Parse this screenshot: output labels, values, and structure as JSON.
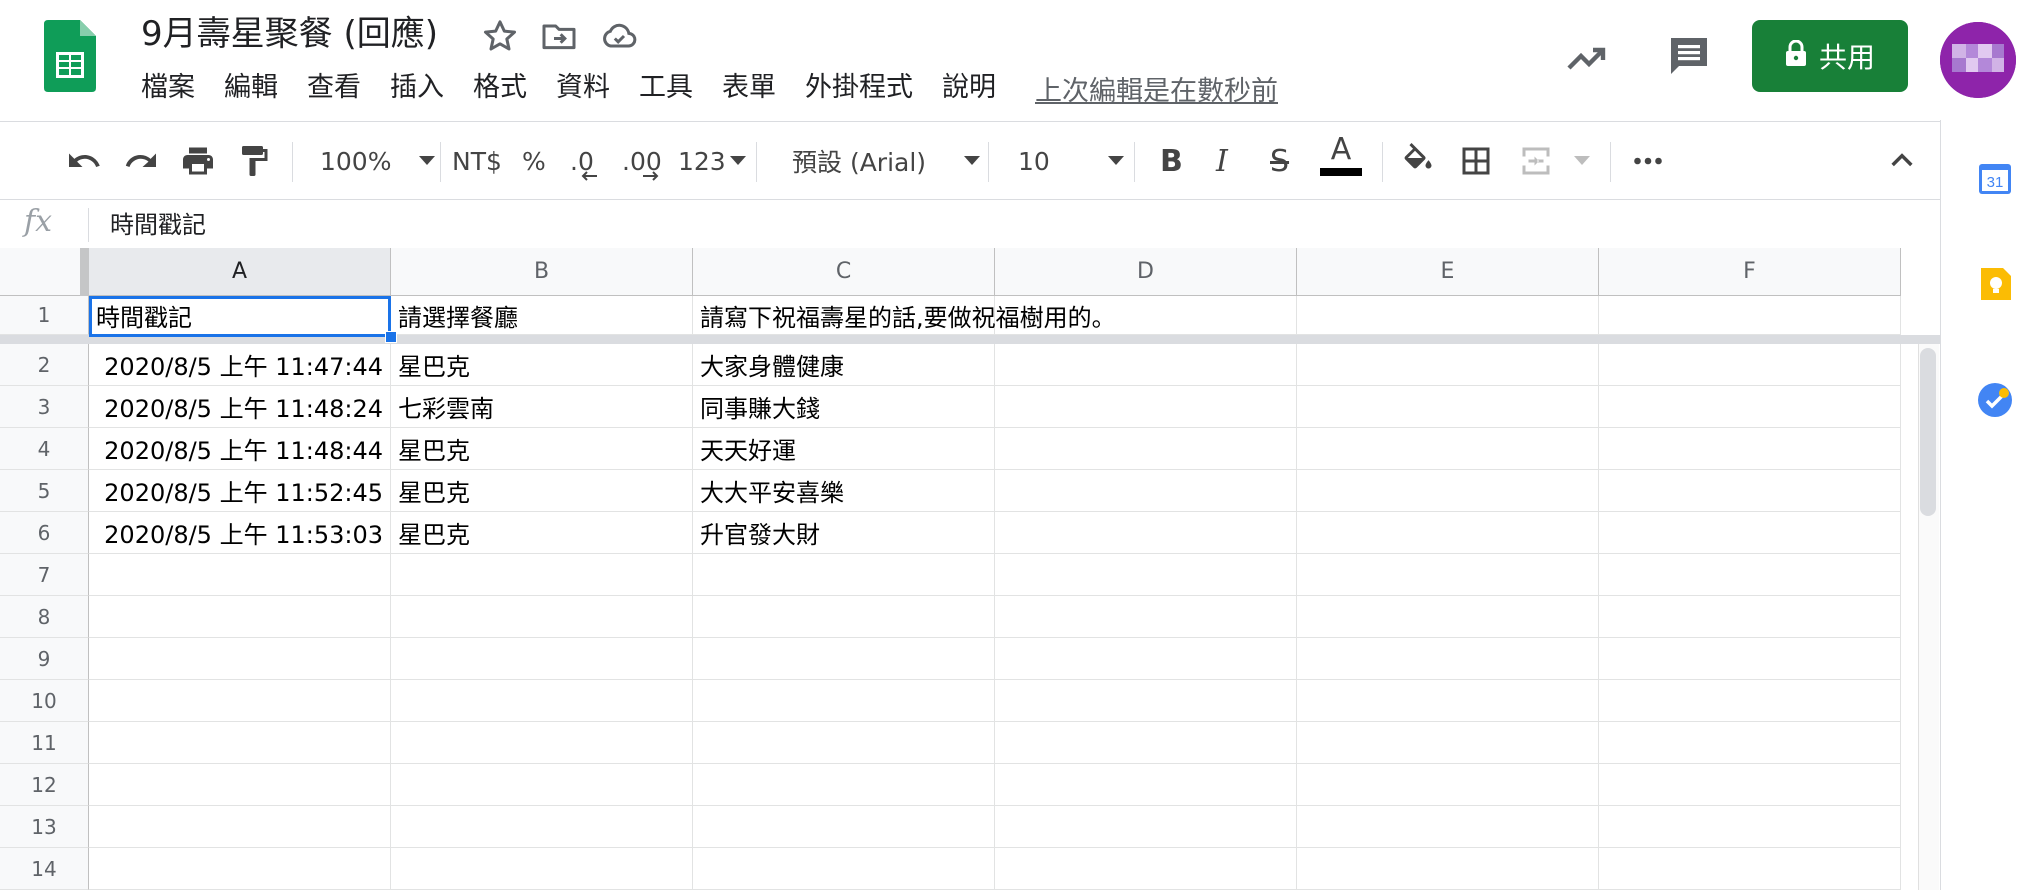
{
  "header": {
    "title": "9月壽星聚餐 (回應)",
    "menus": [
      "檔案",
      "編輯",
      "查看",
      "插入",
      "格式",
      "資料",
      "工具",
      "表單",
      "外掛程式",
      "說明"
    ],
    "last_edit": "上次編輯是在數秒前",
    "share_label": "共用"
  },
  "toolbar": {
    "zoom": "100%",
    "currency": "NT$",
    "percent": "%",
    "decrease_decimal": ".0",
    "increase_decimal": ".00",
    "more_formats": "123",
    "font": "預設 (Arial)",
    "font_size": "10",
    "bold": "B",
    "italic": "I",
    "strikethrough": "S",
    "text_color": "A",
    "text_color_value": "#000000"
  },
  "formula_bar": {
    "fx": "fx",
    "value": "時間戳記"
  },
  "sheet": {
    "columns": [
      "A",
      "B",
      "C",
      "D",
      "E",
      "F"
    ],
    "rows": [
      {
        "num": "1",
        "cells": [
          "時間戳記",
          "請選擇餐廳",
          "請寫下祝福壽星的話,要做祝福樹用的。",
          "",
          "",
          ""
        ]
      },
      {
        "num": "2",
        "cells": [
          "2020/8/5 上午 11:47:44",
          "星巴克",
          "大家身體健康",
          "",
          "",
          ""
        ]
      },
      {
        "num": "3",
        "cells": [
          "2020/8/5 上午 11:48:24",
          "七彩雲南",
          "同事賺大錢",
          "",
          "",
          ""
        ]
      },
      {
        "num": "4",
        "cells": [
          "2020/8/5 上午 11:48:44",
          "星巴克",
          "天天好運",
          "",
          "",
          ""
        ]
      },
      {
        "num": "5",
        "cells": [
          "2020/8/5 上午 11:52:45",
          "星巴克",
          "大大平安喜樂",
          "",
          "",
          ""
        ]
      },
      {
        "num": "6",
        "cells": [
          "2020/8/5 上午 11:53:03",
          "星巴克",
          "升官發大財",
          "",
          "",
          ""
        ]
      },
      {
        "num": "7",
        "cells": [
          "",
          "",
          "",
          "",
          "",
          ""
        ]
      },
      {
        "num": "8",
        "cells": [
          "",
          "",
          "",
          "",
          "",
          ""
        ]
      },
      {
        "num": "9",
        "cells": [
          "",
          "",
          "",
          "",
          "",
          ""
        ]
      },
      {
        "num": "10",
        "cells": [
          "",
          "",
          "",
          "",
          "",
          ""
        ]
      },
      {
        "num": "11",
        "cells": [
          "",
          "",
          "",
          "",
          "",
          ""
        ]
      },
      {
        "num": "12",
        "cells": [
          "",
          "",
          "",
          "",
          "",
          ""
        ]
      },
      {
        "num": "13",
        "cells": [
          "",
          "",
          "",
          "",
          "",
          ""
        ]
      },
      {
        "num": "14",
        "cells": [
          "",
          "",
          "",
          "",
          "",
          ""
        ]
      }
    ]
  },
  "side_panel": {
    "calendar_day": "31"
  },
  "colors": {
    "share_green": "#188038",
    "selection_blue": "#1a73e8",
    "sheets_green": "#0f9d58"
  }
}
